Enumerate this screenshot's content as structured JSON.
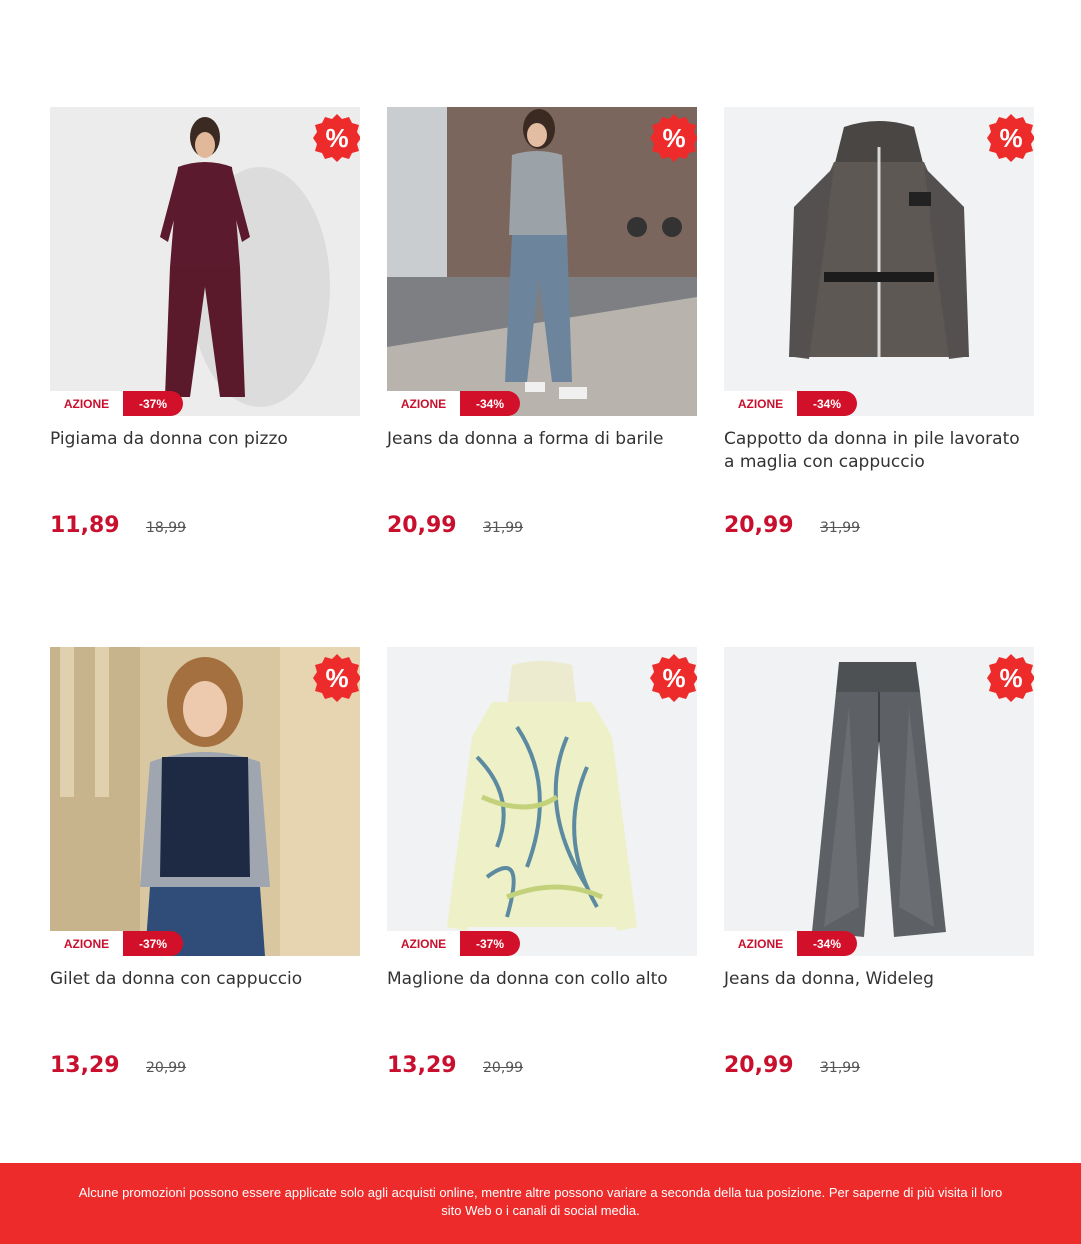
{
  "products": [
    {
      "title": "Pigiama da donna con pizzo",
      "price": "11,89",
      "old_price": "18,99",
      "sale_label": "AZIONE",
      "discount": "-37%",
      "badge": "%"
    },
    {
      "title": "Jeans da donna a forma di barile",
      "price": "20,99",
      "old_price": "31,99",
      "sale_label": "AZIONE",
      "discount": "-34%",
      "badge": "%"
    },
    {
      "title": "Cappotto da donna in pile lavorato a maglia con cappuccio",
      "price": "20,99",
      "old_price": "31,99",
      "sale_label": "AZIONE",
      "discount": "-34%",
      "badge": "%"
    },
    {
      "title": "Gilet da donna con cappuccio",
      "price": "13,29",
      "old_price": "20,99",
      "sale_label": "AZIONE",
      "discount": "-37%",
      "badge": "%"
    },
    {
      "title": "Maglione da donna con collo alto",
      "price": "13,29",
      "old_price": "20,99",
      "sale_label": "AZIONE",
      "discount": "-37%",
      "badge": "%"
    },
    {
      "title": "Jeans da donna, Wideleg",
      "price": "20,99",
      "old_price": "31,99",
      "sale_label": "AZIONE",
      "discount": "-34%",
      "badge": "%"
    }
  ],
  "footer": {
    "text": "Alcune promozioni possono essere applicate solo agli acquisti online, mentre altre possono variare a seconda della tua posizione. Per saperne di più visita il loro sito Web o i canali di social media."
  },
  "colors": {
    "accent": "#c8102e",
    "badge": "#ee2b2b",
    "footer_bg": "#ee2b2b"
  },
  "icons": [
    "percent-badge-icon"
  ]
}
